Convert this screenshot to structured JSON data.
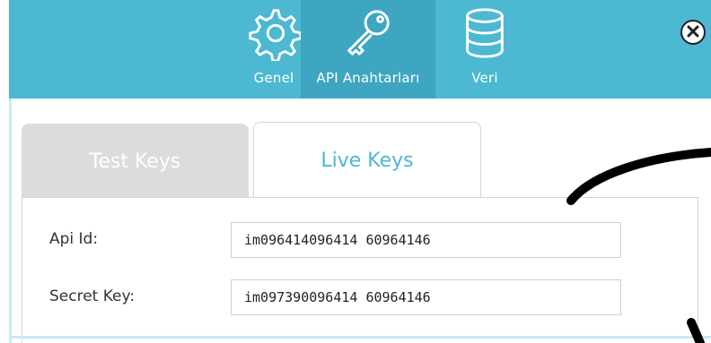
{
  "nav": {
    "items": [
      {
        "label": "Genel",
        "icon": "gear-icon"
      },
      {
        "label": "API Anahtarları",
        "icon": "key-icon"
      },
      {
        "label": "Veri",
        "icon": "database-icon"
      }
    ],
    "active": "API Anahtarları",
    "close_icon": "close-icon"
  },
  "tabs": [
    {
      "label": "Test Keys",
      "active": false
    },
    {
      "label": "Live Keys",
      "active": true
    }
  ],
  "fields": {
    "api_id": {
      "label": "Api Id:",
      "value": "im096414096414 60964146"
    },
    "secret_key": {
      "label": "Secret Key:",
      "value": "im097390096414 60964146"
    }
  },
  "colors": {
    "accent": "#4cb8d1",
    "accent_dark": "#3ea6c0",
    "inactive_tab": "#dcdcdc"
  }
}
